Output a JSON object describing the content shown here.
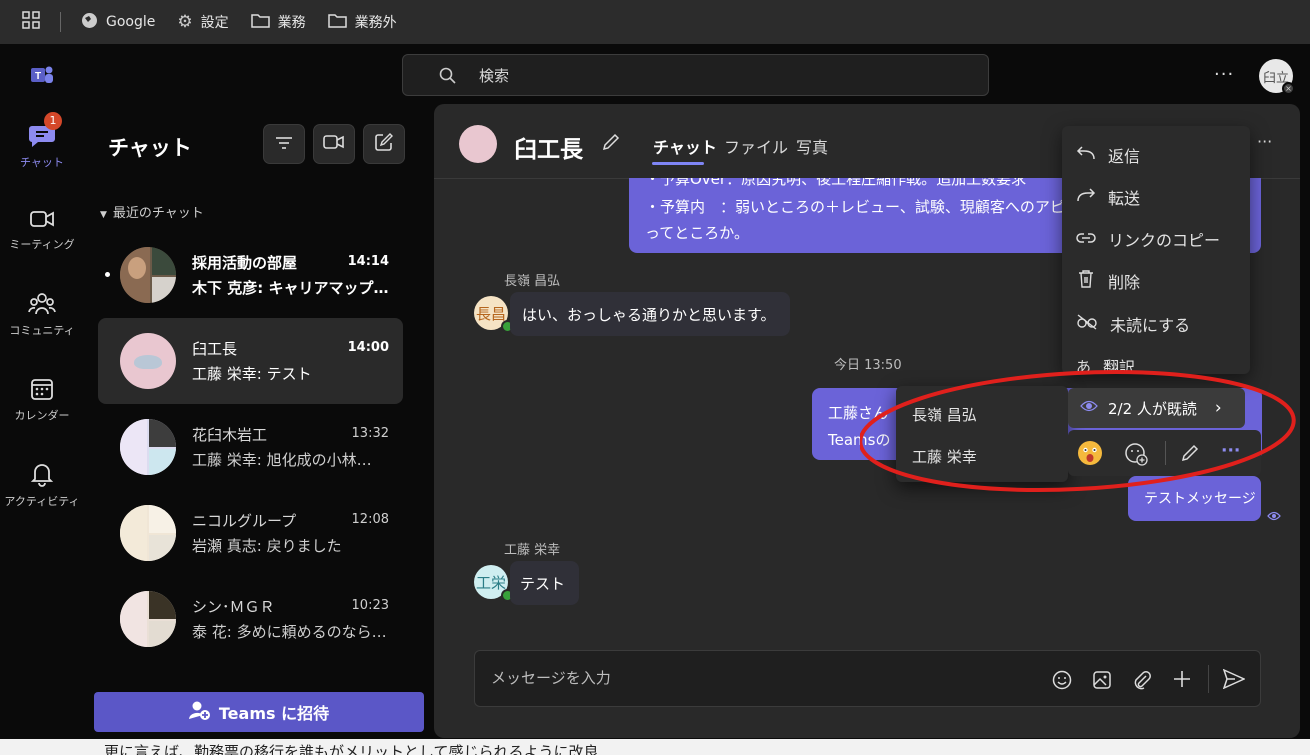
{
  "bookmarks": [
    "Google",
    "設定",
    "業務",
    "業務外"
  ],
  "search": {
    "placeholder": "検索"
  },
  "profile": {
    "initials": "臼立"
  },
  "rail": [
    {
      "label": "チャット",
      "badge": "1"
    },
    {
      "label": "ミーティング"
    },
    {
      "label": "コミュニティ"
    },
    {
      "label": "カレンダー"
    },
    {
      "label": "アクティビティ"
    }
  ],
  "list": {
    "title": "チャット",
    "section": "最近のチャット",
    "items": [
      {
        "name": "採用活動の部屋",
        "time": "14:14",
        "preview": "木下 克彦: キャリアマップ…",
        "unread": true
      },
      {
        "name": "臼工長",
        "time": "14:00",
        "preview": "工藤 栄幸: テスト",
        "selected": true
      },
      {
        "name": "花臼木岩工",
        "time": "13:32",
        "preview": "工藤 栄幸: 旭化成の小林…"
      },
      {
        "name": "ニコルグループ",
        "time": "12:08",
        "preview": "岩瀬 真志: 戻りました"
      },
      {
        "name": "シン･ＭＧＲ",
        "time": "10:23",
        "preview": "泰 花: 多めに頼めるのなら…"
      }
    ],
    "invite": "Teams に招待"
  },
  "chat": {
    "title": "臼工長",
    "tabs": [
      "チャット",
      "ファイル",
      "写真"
    ],
    "top_message": [
      "・予算Over：原因究明、後工程圧縮作戦。追加工数要求",
      "・予算内　：弱いところの＋レビュー、試験、現顧客へのアピー",
      "ってところか。"
    ],
    "msg1": {
      "sender": "長嶺 昌弘",
      "avatar": "長昌",
      "text": "はい、おっしゃる通りかと思います。"
    },
    "timestamp": "今日 13:50",
    "msg2_partial": [
      "工藤さん",
      "Teamsの"
    ],
    "msg3": "テストメッセージ",
    "msg4": {
      "sender": "工藤 栄幸",
      "avatar": "工栄",
      "text": "テスト"
    },
    "compose_placeholder": "メッセージを入力"
  },
  "context_menu": [
    "返信",
    "転送",
    "リンクのコピー",
    "削除",
    "未読にする",
    "翻訳"
  ],
  "read_receipt": {
    "label": "2/2 人が既読",
    "readers": [
      "長嶺 昌弘",
      "工藤 栄幸"
    ]
  },
  "doc_text": "更に言えば、勤務票の移行を誰もがメリットとして感じられるように改良"
}
